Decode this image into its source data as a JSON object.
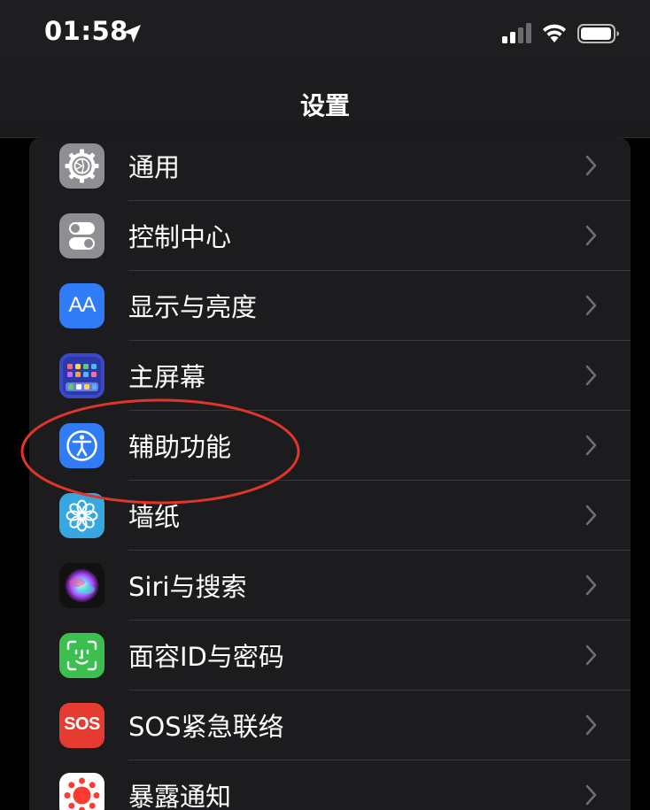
{
  "status_bar": {
    "time": "01:58",
    "icons": [
      "location-arrow-icon",
      "cellular-signal-icon",
      "wifi-icon",
      "battery-icon"
    ]
  },
  "nav": {
    "title": "设置"
  },
  "settings": {
    "items": [
      {
        "label": "通用",
        "icon": "gear-icon",
        "color": "#8e8e93"
      },
      {
        "label": "控制中心",
        "icon": "toggles-icon",
        "color": "#8e8e93"
      },
      {
        "label": "显示与亮度",
        "icon": "text-size-icon",
        "icon_text": "AA",
        "color": "#2f7cf6"
      },
      {
        "label": "主屏幕",
        "icon": "home-screen-grid-icon",
        "color": "#3b47c9"
      },
      {
        "label": "辅助功能",
        "icon": "accessibility-icon",
        "color": "#2f7cf6",
        "highlighted": true
      },
      {
        "label": "墙纸",
        "icon": "flower-icon",
        "color": "#36a7e0"
      },
      {
        "label": "Siri与搜索",
        "icon": "siri-icon",
        "color": "#111111"
      },
      {
        "label": "面容ID与密码",
        "icon": "face-id-icon",
        "color": "#3bbf4f"
      },
      {
        "label": "SOS紧急联络",
        "icon": "sos-icon",
        "icon_text": "SOS",
        "color": "#e53b30"
      },
      {
        "label": "暴露通知",
        "icon": "exposure-notification-icon",
        "color": "#ffffff"
      }
    ]
  },
  "annotation": {
    "shape": "oval",
    "color": "#e0352b",
    "target": "辅助功能"
  }
}
